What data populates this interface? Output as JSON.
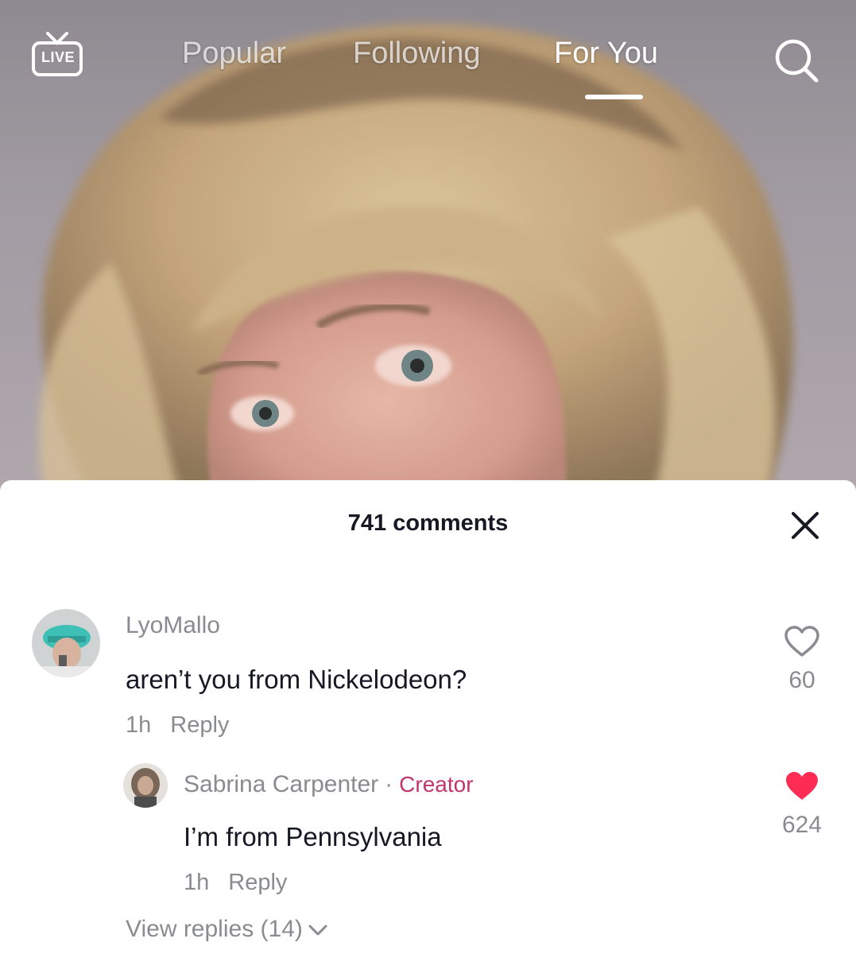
{
  "top_nav": {
    "live_label": "LIVE",
    "tabs": [
      {
        "label": "Popular",
        "active": false
      },
      {
        "label": "Following",
        "active": false
      },
      {
        "label": "For You",
        "active": true
      }
    ],
    "search_icon": "search-icon"
  },
  "comments_sheet": {
    "title": "741 comments",
    "close_icon": "close-icon",
    "comments": [
      {
        "username": "LyoMallo",
        "text": "aren’t you from Nickelodeon?",
        "time": "1h",
        "reply_label": "Reply",
        "likes": "60",
        "liked": false
      }
    ],
    "replies": [
      {
        "username": "Sabrina Carpenter",
        "separator": "·",
        "badge": "Creator",
        "text": "I’m from Pennsylvania",
        "time": "1h",
        "reply_label": "Reply",
        "likes": "624",
        "liked": true
      }
    ],
    "view_replies_label": "View replies (14)"
  },
  "colors": {
    "liked_heart": "#fe2c55",
    "creator_badge": "#c0356b",
    "muted_text": "#8a8b91",
    "primary_text": "#161823"
  }
}
